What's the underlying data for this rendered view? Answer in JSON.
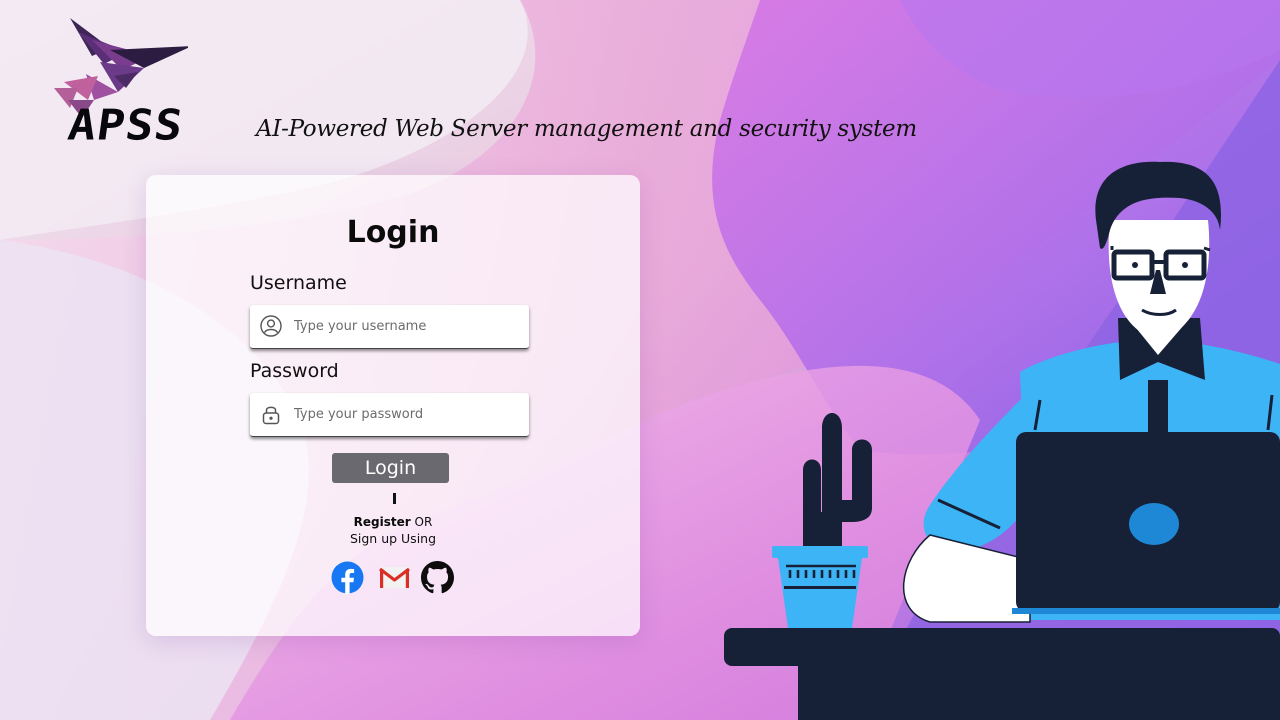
{
  "brand": {
    "logo_text": "APSS",
    "tagline": "AI-Powered Web Server management and security system"
  },
  "login_form": {
    "title": "Login",
    "username_label": "Username",
    "username_placeholder": "Type your username",
    "username_value": "",
    "password_label": "Password",
    "password_placeholder": "Type your password",
    "password_value": "",
    "login_button": "Login",
    "register_link": "Register",
    "or_text": " OR",
    "signup_text": "Sign up Using"
  },
  "social_icons": [
    "facebook-icon",
    "gmail-icon",
    "github-icon"
  ],
  "colors": {
    "button": "#6a6970",
    "facebook": "#1877f2",
    "github": "#0d0d0d",
    "character_shirt": "#3db4f5",
    "laptop": "#162036"
  }
}
